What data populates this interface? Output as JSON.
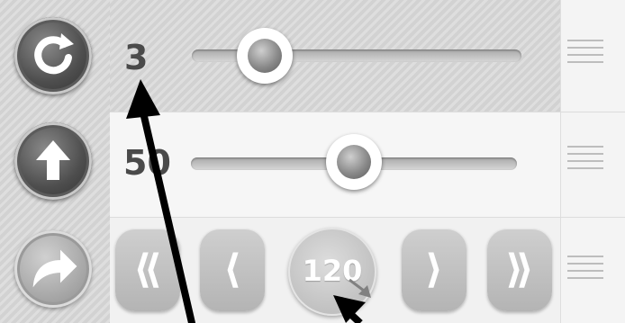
{
  "rows": [
    {
      "icon": "refresh-icon",
      "value": "3",
      "slider_level": 0.22
    },
    {
      "icon": "arrow-up-icon",
      "value": "50",
      "slider_level": 0.5
    },
    {
      "icon": "share-forward-icon"
    }
  ],
  "controls": {
    "first_label": "⟪",
    "prev_label": "⟨",
    "center_value": "120",
    "next_label": "⟩",
    "last_label": "⟫"
  },
  "colors": {
    "accent_dark": "#4e4e4e",
    "text": "#4a4a4a",
    "annotation": "#000000"
  }
}
